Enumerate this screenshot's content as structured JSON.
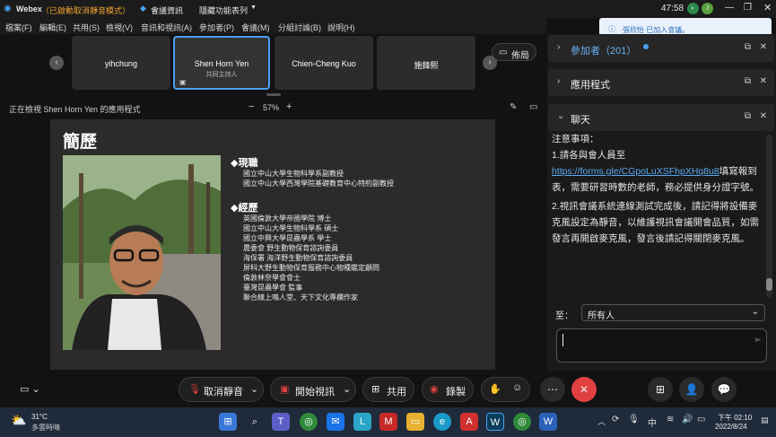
{
  "titlebar": {
    "app": "Webex",
    "mode": "（已啟動取消靜音模式）",
    "meeting_info": "會議資訊",
    "hide_menu": "隱藏功能表列",
    "time": "47:58",
    "avatar_initials": "J"
  },
  "menu": [
    "檔案(F)",
    "編輯(E)",
    "共用(S)",
    "檢視(V)",
    "音訊和視訊(A)",
    "參加者(P)",
    "會議(M)",
    "分組討論(B)",
    "說明(H)"
  ],
  "tiles": [
    {
      "name": "yihchung",
      "sub": ""
    },
    {
      "name": "Shen Horn Yen",
      "sub": "共同主持人"
    },
    {
      "name": "Chien-Cheng Kuo",
      "sub": ""
    },
    {
      "name": "施鋒熙",
      "sub": ""
    }
  ],
  "layout_label": "佈局",
  "viewbar": {
    "viewing": "正在檢視 Shen Horn Yen 的應用程式",
    "zoom": "57%",
    "minus": "−",
    "plus": "+"
  },
  "slide": {
    "title": "簡歷",
    "current_heading": "◆現職",
    "current": [
      "國立中山大學生物科學系副教授",
      "國立中山大學西灣學院基礎教育中心特約副教授"
    ],
    "past_heading": "◆經歷",
    "past": [
      "英國倫敦大學帝國學院 博士",
      "國立中山大學生物科學系 碩士",
      "國立中興大學昆蟲學系 學士",
      "農委會 野生動物保育諮詢委員",
      "海保署 海洋野生動物保育諮詢委員",
      "屏科大野生動物保育服務中心物種鑑定顧問",
      "倫敦林奈學會會士",
      "臺灣昆蟲學會 監事",
      "聯合線上鳴人堂、天下文化專欄作家"
    ]
  },
  "toast": {
    "text": "張欣怡 已加入會議。"
  },
  "panels": {
    "participants": "參加者（201）",
    "apps": "應用程式",
    "chat": "聊天"
  },
  "chat": {
    "heading": "注意事項：",
    "line1": "1.請各與會人員至",
    "link": "https://forms.gle/CGpoLuXSFhpXHq8u8",
    "line1b": "填寫報到表，需要研習時數的老師，務必提供身分證字號。",
    "line2": "2.視訊會議系統連線測試完成後，請記得將設備麥克風設定為靜音，以維護視訊會議開會品質，如需發言再開啟麥克風，發言後請記得關閉麥克風。",
    "to_label": "至：",
    "to_value": "所有人"
  },
  "controls": {
    "unmute": "取消靜音",
    "start_video": "開始視訊",
    "share": "共用",
    "record": "錄製"
  },
  "taskbar": {
    "weather_temp": "31°C",
    "weather_desc": "多雲時晴",
    "ime": "中",
    "time": "下午 02:10",
    "date": "2022/8/24"
  },
  "colors": {
    "accent": "#4aa0f0",
    "danger": "#e04040",
    "link": "#5aa8f0"
  }
}
